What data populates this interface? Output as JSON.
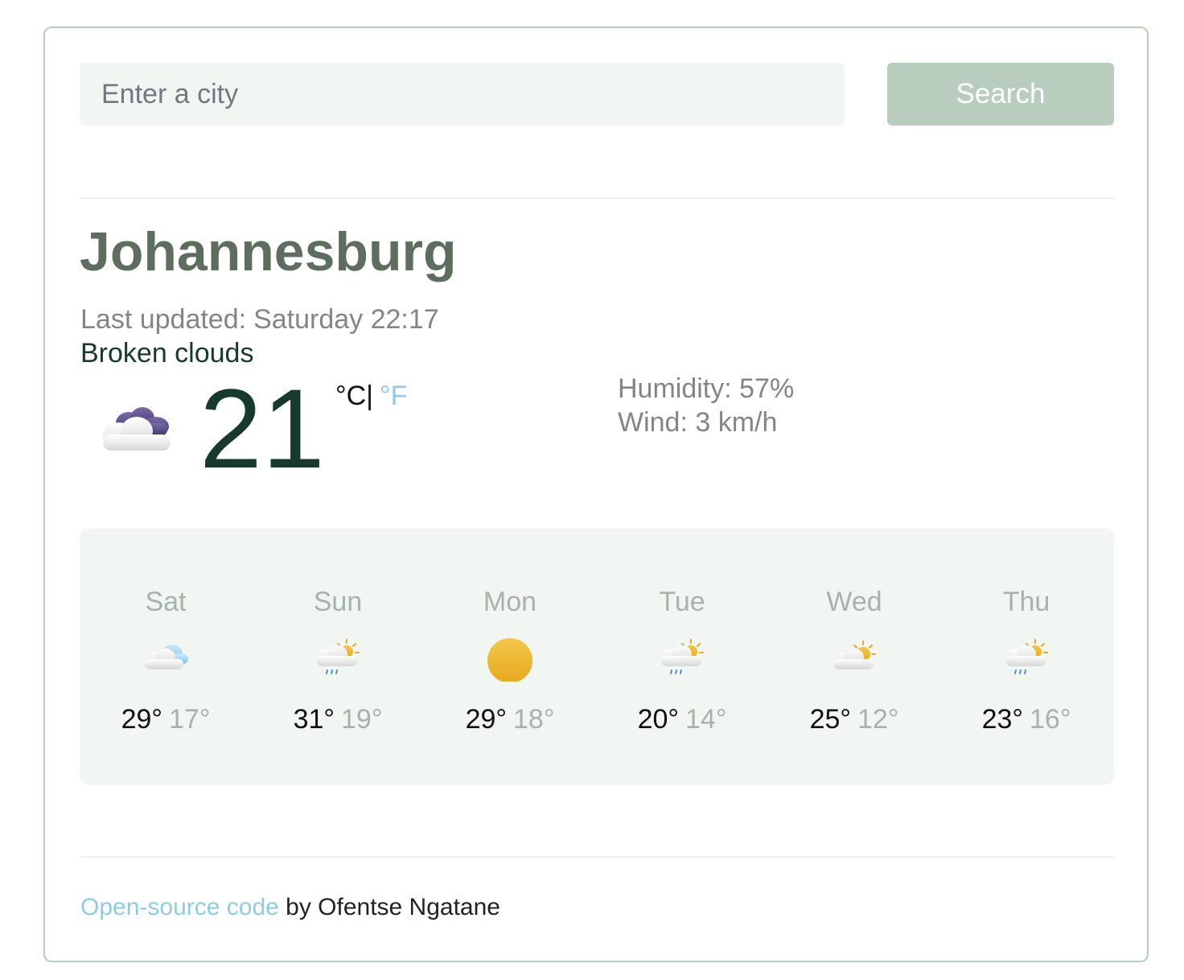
{
  "search": {
    "placeholder": "Enter a city",
    "value": "",
    "button_label": "Search"
  },
  "current": {
    "city": "Johannesburg",
    "last_updated_label": "Last updated:",
    "last_updated_value": "Saturday 22:17",
    "description": "Broken clouds",
    "temperature": "21",
    "unit_celsius": "°C",
    "unit_separator": "|",
    "unit_fahrenheit": "°F",
    "humidity_label": "Humidity: 57%",
    "wind_label": "Wind: 3 km/h",
    "icon": "broken-clouds-night-icon"
  },
  "forecast": [
    {
      "day": "Sat",
      "max": "29°",
      "min": "17°",
      "icon": "cloudy-icon"
    },
    {
      "day": "Sun",
      "max": "31°",
      "min": "19°",
      "icon": "sun-rain-cloud-icon"
    },
    {
      "day": "Mon",
      "max": "29°",
      "min": "18°",
      "icon": "sun-icon"
    },
    {
      "day": "Tue",
      "max": "20°",
      "min": "14°",
      "icon": "sun-rain-cloud-icon"
    },
    {
      "day": "Wed",
      "max": "25°",
      "min": "12°",
      "icon": "partly-cloudy-icon"
    },
    {
      "day": "Thu",
      "max": "23°",
      "min": "16°",
      "icon": "sun-rain-cloud-icon"
    }
  ],
  "footer": {
    "link_text": "Open-source code",
    "suffix": " by Ofentse Ngatane"
  },
  "colors": {
    "accent": "#b9cdbf",
    "input_bg": "#f2f6f2",
    "city_text": "#5d6e5f",
    "dark_text": "#173a2e",
    "link": "#8ecbe6",
    "muted": "#a6b3a9"
  }
}
